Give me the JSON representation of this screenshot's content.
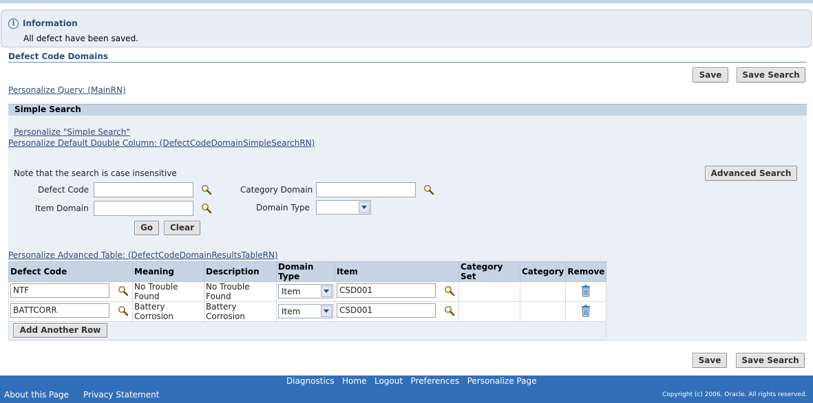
{
  "message": {
    "title": "Information",
    "text": "All defect have been saved."
  },
  "page": {
    "title": "Defect Code Domains",
    "save_label": "Save",
    "save_search_label": "Save Search",
    "personalize_query": "Personalize Query: (MainRN)"
  },
  "simple_search": {
    "header": "Simple Search",
    "personalize_link": "Personalize \"Simple Search\"",
    "personalize_double_column": "Personalize Default Double Column: (DefectCodeDomainSimpleSearchRN)",
    "note": "Note that the search is case insensitive",
    "advanced_search_label": "Advanced Search",
    "fields": {
      "defect_code_label": "Defect Code",
      "defect_code_value": "",
      "category_domain_label": "Category Domain",
      "category_domain_value": "",
      "item_domain_label": "Item Domain",
      "item_domain_value": "",
      "domain_type_label": "Domain Type",
      "domain_type_value": ""
    },
    "go_label": "Go",
    "clear_label": "Clear"
  },
  "results": {
    "personalize_table": "Personalize Advanced Table: (DefectCodeDomainResultsTableRN)",
    "columns": [
      "Defect Code",
      "Meaning",
      "Description",
      "Domain Type",
      "Item",
      "Category Set",
      "Category",
      "Remove"
    ],
    "rows": [
      {
        "defect_code": "NTF",
        "meaning": "No Trouble Found",
        "description": "No Trouble Found",
        "domain_type": "Item",
        "item": "CSD001",
        "category_set": "",
        "category": ""
      },
      {
        "defect_code": "BATTCORR",
        "meaning": "Battery Corrosion",
        "description": "Battery Corrosion",
        "domain_type": "Item",
        "item": "CSD001",
        "category_set": "",
        "category": ""
      }
    ],
    "add_row_label": "Add Another Row"
  },
  "footer": {
    "links": [
      "Diagnostics",
      "Home",
      "Logout",
      "Preferences",
      "Personalize Page"
    ],
    "about": "About this Page",
    "privacy": "Privacy Statement",
    "copyright": "Copyright (c) 2006, Oracle. All rights reserved."
  },
  "icons": {
    "search": "magnifier-icon",
    "remove": "trash-icon",
    "info": "info-icon"
  },
  "colors": {
    "header_blue": "#c6d4e5",
    "link": "#2d4b77",
    "footer": "#336fb8"
  }
}
